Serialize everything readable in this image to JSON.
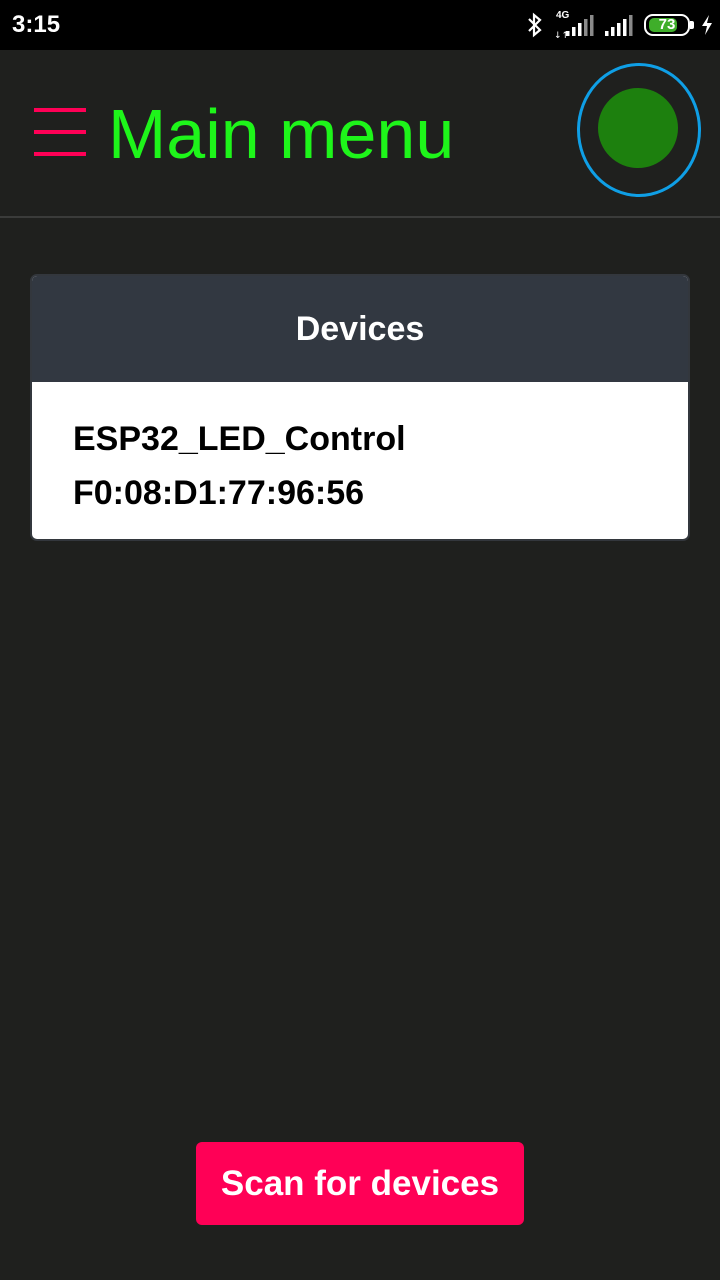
{
  "status_bar": {
    "time": "3:15",
    "network_label": "4G",
    "battery_percent": "73",
    "battery_level": 0.73,
    "icons": [
      "bluetooth-icon",
      "signal-icon",
      "signal-icon",
      "battery-icon",
      "charging-icon"
    ]
  },
  "header": {
    "title": "Main menu",
    "menu_icon": "hamburger-menu-icon",
    "connection_status": "connected",
    "colors": {
      "title": "#1ef51a",
      "accent": "#ff0056",
      "status_ring": "#0f9fe6",
      "status_dot": "#1d800e"
    }
  },
  "devices": {
    "title": "Devices",
    "items": [
      {
        "name": "ESP32_LED_Control",
        "address": "F0:08:D1:77:96:56"
      }
    ]
  },
  "scan_button": {
    "label": "Scan for devices"
  }
}
